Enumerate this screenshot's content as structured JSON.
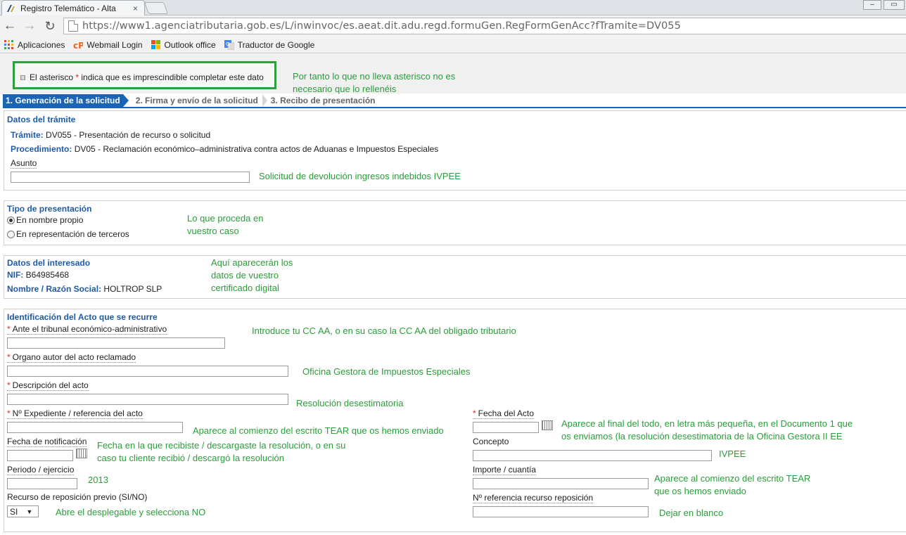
{
  "browser": {
    "tab_title": "Registro Telemático - Alta",
    "url": "https://www1.agenciatributaria.gob.es/L/inwinvoc/es.aeat.dit.adu.regd.formuGen.RegFormGenAcc?fTramite=DV055",
    "bookmarks": [
      {
        "label": "Aplicaciones",
        "icon": "apps-grid-icon"
      },
      {
        "label": "Webmail Login",
        "icon": "cpanel-icon"
      },
      {
        "label": "Outlook office",
        "icon": "microsoft-icon"
      },
      {
        "label": "Traductor de Google",
        "icon": "google-translate-icon"
      }
    ]
  },
  "notice": {
    "before": "El asterisco ",
    "star": "*",
    "after": " indica que es imprescindible completar este dato"
  },
  "annotations": {
    "asterisk_note_1": "Por tanto lo que no lleva asterisco no es",
    "asterisk_note_2": "necesario que lo rellenéis",
    "asunto": "Solicitud de devolución ingresos indebidos IVPEE",
    "tipo_1": "Lo que proceda en",
    "tipo_2": "vuestro caso",
    "interesado_1": "Aquí aparecerán los",
    "interesado_2": "datos de vuestro",
    "interesado_3": "certificado digital",
    "tribunal": "Introduce tu  CC AA, o en su caso  la CC AA del obligado tributario",
    "organo": "Oficina Gestora de Impuestos Especiales",
    "descripcion": "Resolución desestimatoria",
    "expediente": "Aparece al comienzo del escrito TEAR que os hemos enviado",
    "notificacion_1": "Fecha en la que recibiste / descargaste la resolución, o en su",
    "notificacion_2": "caso tu cliente recibió / descargó la resolución",
    "periodo": "2013",
    "recurso": "Abre el desplegable y selecciona NO",
    "fecha_acto_1": "Aparece al final del todo, en letra más pequeña, en el Documento 1 que",
    "fecha_acto_2": "os enviamos (la resolución desestimatoria de la Oficina Gestora II EE",
    "concepto": "IVPEE",
    "importe_1": "Aparece al comienzo del escrito TEAR",
    "importe_2": "que os hemos enviado",
    "referencia": "Dejar en blanco"
  },
  "steps": [
    "1. Generación de la solicitud",
    "2. Firma y envío de la solicitud",
    "3. Recibo de presentación"
  ],
  "tramite_section": {
    "title": "Datos del trámite",
    "tramite_label": "Trámite:",
    "tramite_value": " DV055 - Presentación de recurso o solicitud",
    "procedimiento_label": "Procedimiento:",
    "procedimiento_value": " DV05 - Reclamación económico–administrativa contra actos de Aduanas e Impuestos Especiales",
    "asunto_label": "Asunto",
    "asunto_value": ""
  },
  "tipo_section": {
    "title": "Tipo de presentación",
    "options": [
      "En nombre propio",
      "En representación de terceros"
    ],
    "selected_index": 0
  },
  "interesado_section": {
    "title": "Datos del interesado",
    "nif_label": "NIF:",
    "nif_value": " B64985468",
    "nombre_label": "Nombre / Razón Social:",
    "nombre_value": " HOLTROP SLP"
  },
  "acto_section": {
    "title": "Identificación del Acto que se recurre",
    "tribunal_label": "Ante el tribunal económico-administrativo",
    "organo_label": "Organo autor del acto reclamado",
    "descripcion_label": "Descripción del acto",
    "expediente_label": "Nº Expediente / referencia del acto",
    "notificacion_label": "Fecha de notificación",
    "periodo_label": "Periodo / ejercicio",
    "recurso_label": "Recurso de reposición previo (SI/NO)",
    "recurso_value": "SI",
    "fecha_acto_label": "Fecha del Acto",
    "concepto_label": "Concepto",
    "importe_label": "Importe / cuantía",
    "referencia_label": "Nº referencia recurso reposición"
  },
  "colors": {
    "accent_blue": "#1a63b5",
    "annotation_green": "#2a9d3a",
    "required_red": "#dd2222",
    "highlight_box": "#2e9e3e"
  }
}
